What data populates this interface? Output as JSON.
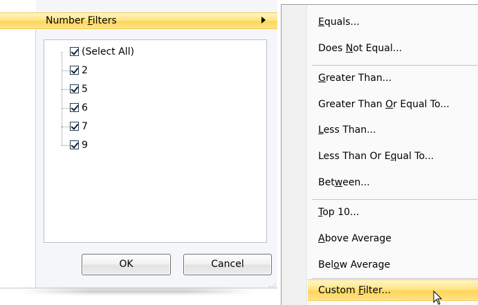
{
  "filter_panel": {
    "number_filters": {
      "pre": "Number ",
      "accel": "F",
      "post": "ilters"
    },
    "values": [
      {
        "label": "(Select All)",
        "checked": true
      },
      {
        "label": "2",
        "checked": true
      },
      {
        "label": "5",
        "checked": true
      },
      {
        "label": "6",
        "checked": true
      },
      {
        "label": "7",
        "checked": true
      },
      {
        "label": "9",
        "checked": true
      }
    ],
    "ok_label": "OK",
    "cancel_label": "Cancel",
    "grip": "..:"
  },
  "submenu": {
    "items": [
      {
        "pre": "",
        "accel": "E",
        "post": "quals..."
      },
      {
        "pre": "Does ",
        "accel": "N",
        "post": "ot Equal..."
      },
      {
        "pre": "",
        "accel": "G",
        "post": "reater Than..."
      },
      {
        "pre": "Greater Than ",
        "accel": "O",
        "post": "r Equal To..."
      },
      {
        "pre": "",
        "accel": "L",
        "post": "ess Than..."
      },
      {
        "pre": "Less Than Or E",
        "accel": "q",
        "post": "ual To..."
      },
      {
        "pre": "Bet",
        "accel": "w",
        "post": "een..."
      },
      {
        "pre": "",
        "accel": "T",
        "post": "op 10..."
      },
      {
        "pre": "",
        "accel": "A",
        "post": "bove Average"
      },
      {
        "pre": "Bel",
        "accel": "o",
        "post": "w Average"
      },
      {
        "pre": "Custom ",
        "accel": "F",
        "post": "ilter..."
      }
    ],
    "highlighted_index": 10
  }
}
